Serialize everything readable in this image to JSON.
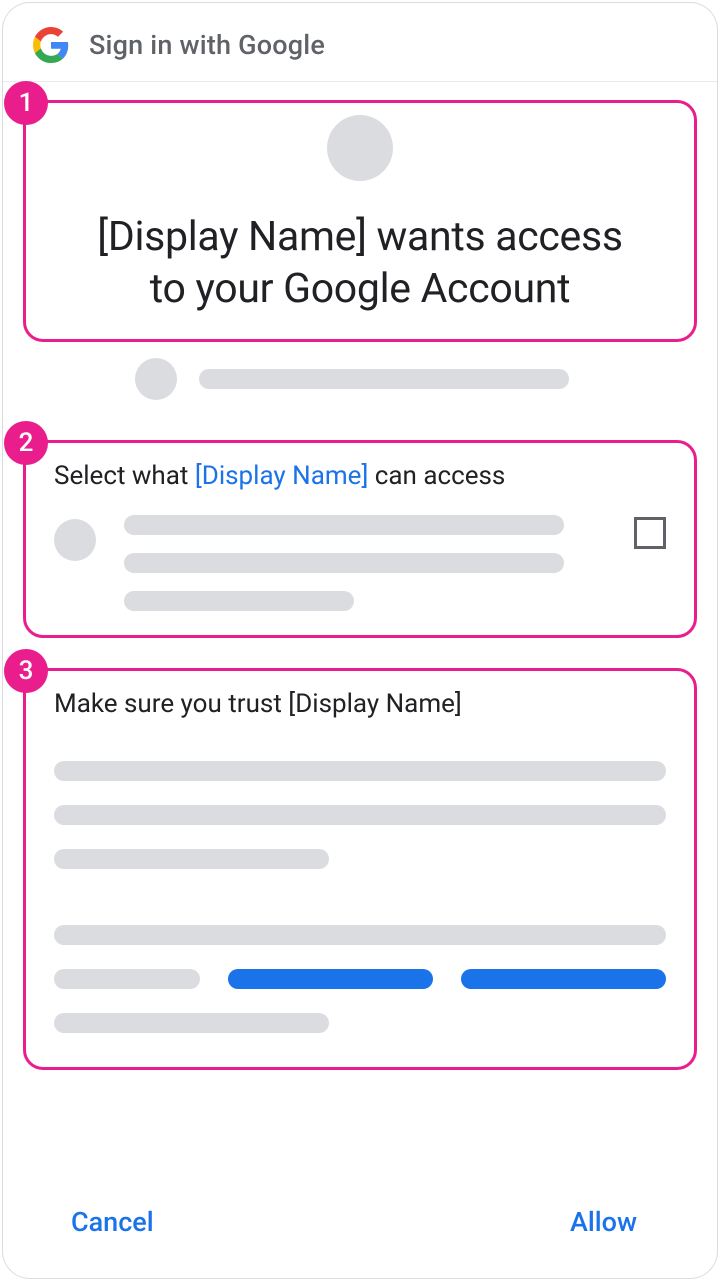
{
  "header": {
    "title": "Sign in with Google"
  },
  "annotations": {
    "badge1": "1",
    "badge2": "2",
    "badge3": "3"
  },
  "section1": {
    "title_line1": "[Display Name] wants access",
    "title_line2": "to your Google Account"
  },
  "section2": {
    "heading_pre": "Select what ",
    "heading_link": "[Display Name]",
    "heading_post": " can access"
  },
  "section3": {
    "heading": "Make sure you trust [Display Name]"
  },
  "footer": {
    "cancel": "Cancel",
    "allow": "Allow"
  }
}
